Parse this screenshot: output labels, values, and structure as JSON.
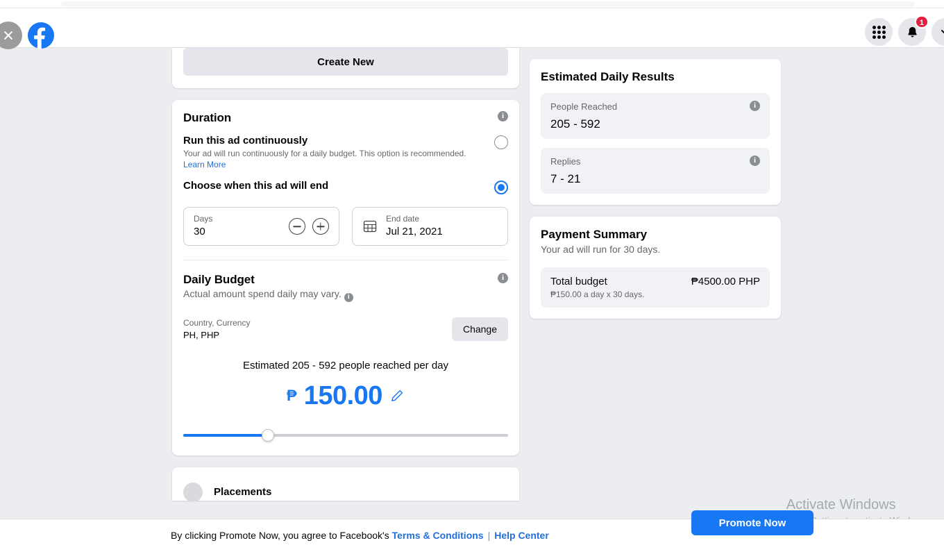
{
  "topbar": {
    "close_label": "close-icon",
    "logo_label": "facebook-logo",
    "menu_label": "apps-grid-icon",
    "notifications_label": "bell-icon",
    "notifications_badge": "1",
    "account_label": "chevron-down-icon"
  },
  "left": {
    "create_new_label": "Create New",
    "duration": {
      "title": "Duration",
      "continuous": {
        "label": "Run this ad continuously",
        "sub": "Your ad will run continuously for a daily budget. This option is recommended.",
        "link": "Learn More",
        "selected": false
      },
      "scheduled": {
        "label": "Choose when this ad will end",
        "selected": true
      },
      "days_field": {
        "label": "Days",
        "value": "30"
      },
      "end_date_field": {
        "label": "End date",
        "value": "Jul 21, 2021",
        "icon": "calendar-icon"
      }
    },
    "budget": {
      "title": "Daily Budget",
      "sub": "Actual amount spend daily may vary.",
      "country_label": "Country, Currency",
      "country_value": "PH, PHP",
      "change_label": "Change",
      "estimate_line": "Estimated 205 - 592 people reached per day",
      "currency_symbol": "₱",
      "amount": "150.00",
      "edit_icon": "pencil-icon",
      "slider_percent": 26
    },
    "placements": {
      "label": "Placements"
    }
  },
  "right": {
    "estimated": {
      "title": "Estimated Daily Results",
      "stats": [
        {
          "label": "People Reached",
          "value": "205 - 592"
        },
        {
          "label": "Replies",
          "value": "7 - 21"
        }
      ]
    },
    "payment": {
      "title": "Payment Summary",
      "sub": "Your ad will run for 30 days.",
      "total_label": "Total budget",
      "total_amount": "₱4500.00 PHP",
      "note": "₱150.00 a day x 30 days."
    }
  },
  "bottom": {
    "tos_prefix": "By clicking Promote Now, you agree to Facebook's ",
    "terms_label": "Terms & Conditions",
    "separator": "|",
    "help_label": "Help Center",
    "promote_label": "Promote Now"
  },
  "watermark": {
    "title": "Activate Windows",
    "sub": "Go to Settings to activate Windows."
  },
  "colors": {
    "accent": "#1877f2",
    "link": "#216fdb",
    "page_bg": "#ebedf0",
    "badge": "#e41e3f",
    "muted": "#65676b"
  }
}
